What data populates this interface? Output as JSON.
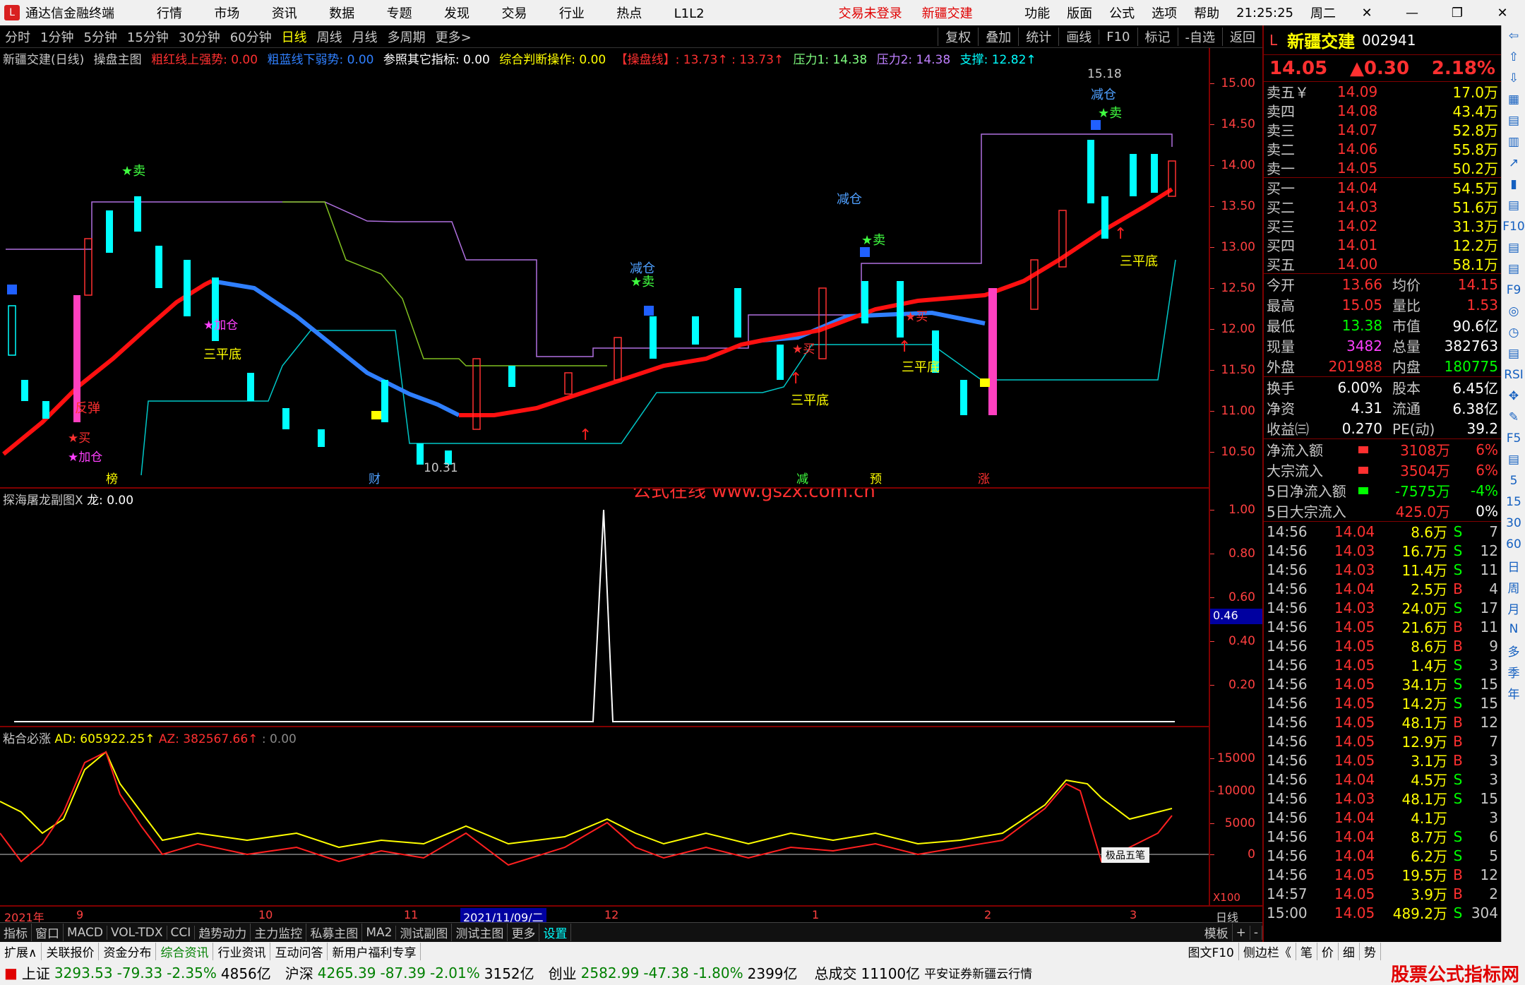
{
  "app": {
    "title": "通达信金融终端",
    "menu": [
      "行情",
      "市场",
      "资讯",
      "数据",
      "专题",
      "发现",
      "交易",
      "行业",
      "热点",
      "L1L2"
    ],
    "trade_status": "交易未登录",
    "stock_title": "新疆交建",
    "right_menu": [
      "功能",
      "版面",
      "公式",
      "选项",
      "帮助"
    ],
    "clock": "21:25:25",
    "weekday": "周二"
  },
  "toolbar": {
    "periods": [
      "分时",
      "1分钟",
      "5分钟",
      "15分钟",
      "30分钟",
      "60分钟",
      "日线",
      "周线",
      "月线",
      "多周期",
      "更多>"
    ],
    "active": "日线",
    "right": [
      "复权",
      "叠加",
      "统计",
      "画线",
      "F10",
      "标记",
      "-自选",
      "返回"
    ]
  },
  "main_legend": {
    "name": "新疆交建(日线)",
    "indicator": "操盘主图",
    "items": [
      {
        "text": "粗红线上强势: 0.00",
        "color": "#ff3030"
      },
      {
        "text": "粗蓝线下弱势: 0.00",
        "color": "#3080ff"
      },
      {
        "text": "参照其它指标: 0.00",
        "color": "#ffffff"
      },
      {
        "text": "综合判断操作: 0.00",
        "color": "#ffff00"
      },
      {
        "text": "【操盘线】: 13.73↑ : 13.73↑",
        "color": "#ff3030"
      },
      {
        "text": "压力1: 14.38",
        "color": "#80ff80"
      },
      {
        "text": "压力2: 14.38",
        "color": "#c080ff"
      },
      {
        "text": "支撑: 12.82↑",
        "color": "#00ffff"
      }
    ]
  },
  "main_yaxis": [
    "15.00",
    "14.50",
    "14.00",
    "13.50",
    "13.00",
    "12.50",
    "12.00",
    "11.50",
    "11.00",
    "10.50"
  ],
  "main_annotations": {
    "high_label": "15.18",
    "low_label": "10.31",
    "jiancang": "减仓",
    "mai": "★卖",
    "mai_buy": "★买",
    "jiacang": "★加仓",
    "fantan": "反弹",
    "sanpingdi": "三平底",
    "bottom_tags": [
      "榜",
      "财",
      "减",
      "预",
      "涨"
    ],
    "watermark": "公式在线  www.gszx.com.cn"
  },
  "sub1": {
    "legend": "探海屠龙副图X",
    "value_label": "龙: 0.00",
    "yaxis": [
      "1.00",
      "0.80",
      "0.60",
      "0.40",
      "0.20"
    ],
    "marker": "0.46"
  },
  "sub2": {
    "legend": "粘合必涨",
    "ad": "AD: 605922.25↑",
    "az": "AZ: 382567.66↑",
    "zero": ": 0.00",
    "yaxis": [
      "15000",
      "10000",
      "5000",
      "0"
    ],
    "tool": "极品五笔",
    "scale": "X100"
  },
  "xaxis": {
    "labels": [
      "2021年",
      "9",
      "10",
      "11",
      "2021/11/09/二",
      "12",
      "1",
      "2",
      "3"
    ],
    "right": "日线"
  },
  "bottom_tabs": [
    "指标",
    "窗口",
    "MACD",
    "VOL-TDX",
    "CCI",
    "趋势动力",
    "主力监控",
    "私募主图",
    "MA2",
    "测试副图",
    "测试主图",
    "更多",
    "设置"
  ],
  "bottom_tabs_selected": "设置",
  "bottom_tabs_right": [
    "模板",
    "+",
    "-"
  ],
  "bottom_tabs2": [
    "扩展∧",
    "关联报价",
    "资金分布",
    "综合资讯",
    "行业资讯",
    "互动问答",
    "新用户福利专享"
  ],
  "bottom_tabs2_right": [
    "图文F10",
    "侧边栏《",
    "笔",
    "价",
    "细",
    "势"
  ],
  "statusbar": {
    "items": [
      {
        "name": "上证",
        "value": "3293.53",
        "chg": "-79.33",
        "pct": "-2.35%",
        "amt": "4856亿"
      },
      {
        "name": "沪深",
        "value": "4265.39",
        "chg": "-87.39",
        "pct": "-2.01%",
        "amt": "3152亿"
      },
      {
        "name": "创业",
        "value": "2582.99",
        "chg": "-47.38",
        "pct": "-1.80%",
        "amt": "2399亿"
      }
    ],
    "total": "总成交",
    "total_amt": "11100亿",
    "broker": "平安证券新疆云行情",
    "corner": "股票公式指标网"
  },
  "quote": {
    "market": "L",
    "name": "新疆交建",
    "code": "002941",
    "price": "14.05",
    "change": "▲0.30",
    "pct": "2.18%",
    "asks": [
      {
        "label": "卖五￥",
        "price": "14.09",
        "vol": "17.0万"
      },
      {
        "label": "卖四",
        "price": "14.08",
        "vol": "43.4万"
      },
      {
        "label": "卖三",
        "price": "14.07",
        "vol": "52.8万"
      },
      {
        "label": "卖二",
        "price": "14.06",
        "vol": "55.8万"
      },
      {
        "label": "卖一",
        "price": "14.05",
        "vol": "50.2万"
      }
    ],
    "bids": [
      {
        "label": "买一",
        "price": "14.04",
        "vol": "54.5万"
      },
      {
        "label": "买二",
        "price": "14.03",
        "vol": "51.6万"
      },
      {
        "label": "买三",
        "price": "14.02",
        "vol": "31.3万"
      },
      {
        "label": "买四",
        "price": "14.01",
        "vol": "12.2万"
      },
      {
        "label": "买五",
        "price": "14.00",
        "vol": "58.1万"
      }
    ],
    "info": [
      {
        "a": "今开",
        "b": "13.66",
        "bc": "#ff3030",
        "c": "均价",
        "d": "14.15",
        "dc": "#ff3030"
      },
      {
        "a": "最高",
        "b": "15.05",
        "bc": "#ff3030",
        "c": "量比",
        "d": "1.53",
        "dc": "#ff3030"
      },
      {
        "a": "最低",
        "b": "13.38",
        "bc": "#00ff00",
        "c": "市值",
        "d": "90.6亿",
        "dc": "#ffffff"
      },
      {
        "a": "现量",
        "b": "3482",
        "bc": "#ff40ff",
        "c": "总量",
        "d": "382763",
        "dc": "#ffffff"
      },
      {
        "a": "外盘",
        "b": "201988",
        "bc": "#ff3030",
        "c": "内盘",
        "d": "180775",
        "dc": "#00ff00"
      }
    ],
    "info2": [
      {
        "a": "换手",
        "b": "6.00%",
        "bc": "#ffffff",
        "c": "股本",
        "d": "6.45亿",
        "dc": "#ffffff"
      },
      {
        "a": "净资",
        "b": "4.31",
        "bc": "#ffffff",
        "c": "流通",
        "d": "6.38亿",
        "dc": "#ffffff"
      },
      {
        "a": "收益㈢",
        "b": "0.270",
        "bc": "#ffffff",
        "c": "PE(动)",
        "d": "39.2",
        "dc": "#ffffff"
      }
    ],
    "flows": [
      {
        "a": "净流入额",
        "bar": "#ff3030",
        "b": "3108万",
        "bc": "#ff3030",
        "c": "6%",
        "cc": "#ff3030"
      },
      {
        "a": "大宗流入",
        "bar": "#ff3030",
        "b": "3504万",
        "bc": "#ff3030",
        "c": "6%",
        "cc": "#ff3030"
      },
      {
        "a": "5日净流入额",
        "bar": "#00ff00",
        "b": "-7575万",
        "bc": "#00ff00",
        "c": "-4%",
        "cc": "#00ff00"
      },
      {
        "a": "5日大宗流入",
        "bar": "#000000",
        "b": "425.0万",
        "bc": "#ff3030",
        "c": "0%",
        "cc": "#ffffff"
      }
    ],
    "ticks": [
      {
        "t": "14:56",
        "p": "14.04",
        "v": "8.6万",
        "s": "S",
        "n": "7"
      },
      {
        "t": "14:56",
        "p": "14.03",
        "v": "16.7万",
        "s": "S",
        "n": "12"
      },
      {
        "t": "14:56",
        "p": "14.03",
        "v": "11.4万",
        "s": "S",
        "n": "11"
      },
      {
        "t": "14:56",
        "p": "14.04",
        "v": "2.5万",
        "s": "B",
        "n": "4"
      },
      {
        "t": "14:56",
        "p": "14.03",
        "v": "24.0万",
        "s": "S",
        "n": "17"
      },
      {
        "t": "14:56",
        "p": "14.05",
        "v": "21.6万",
        "s": "B",
        "n": "11"
      },
      {
        "t": "14:56",
        "p": "14.05",
        "v": "8.6万",
        "s": "B",
        "n": "9"
      },
      {
        "t": "14:56",
        "p": "14.05",
        "v": "1.4万",
        "s": "S",
        "n": "3"
      },
      {
        "t": "14:56",
        "p": "14.05",
        "v": "34.1万",
        "s": "S",
        "n": "15"
      },
      {
        "t": "14:56",
        "p": "14.05",
        "v": "14.2万",
        "s": "S",
        "n": "15"
      },
      {
        "t": "14:56",
        "p": "14.05",
        "v": "48.1万",
        "s": "B",
        "n": "12"
      },
      {
        "t": "14:56",
        "p": "14.05",
        "v": "12.9万",
        "s": "B",
        "n": "7"
      },
      {
        "t": "14:56",
        "p": "14.05",
        "v": "3.1万",
        "s": "B",
        "n": "3"
      },
      {
        "t": "14:56",
        "p": "14.04",
        "v": "4.5万",
        "s": "S",
        "n": "3"
      },
      {
        "t": "14:56",
        "p": "14.03",
        "v": "48.1万",
        "s": "S",
        "n": "15"
      },
      {
        "t": "14:56",
        "p": "14.04",
        "v": "4.1万",
        "s": "",
        "n": "3"
      },
      {
        "t": "14:56",
        "p": "14.04",
        "v": "8.7万",
        "s": "S",
        "n": "6"
      },
      {
        "t": "14:56",
        "p": "14.04",
        "v": "6.2万",
        "s": "S",
        "n": "5"
      },
      {
        "t": "14:56",
        "p": "14.05",
        "v": "19.5万",
        "s": "B",
        "n": "12"
      },
      {
        "t": "14:57",
        "p": "14.05",
        "v": "3.9万",
        "s": "B",
        "n": "2"
      },
      {
        "t": "15:00",
        "p": "14.05",
        "v": "489.2万",
        "s": "S",
        "n": "304"
      }
    ]
  },
  "iconstrip": [
    "⇦",
    "⇧",
    "⇩",
    "▦",
    "▤",
    "▥",
    "↗",
    "▮",
    "▤",
    "F10",
    "▤",
    "▤",
    "F9",
    "◎",
    "◷",
    "▤",
    "RSI",
    "✥",
    "✎",
    "F5",
    "▤",
    "5",
    "15",
    "30",
    "60",
    "日",
    "周",
    "月",
    "N",
    "多",
    "季",
    "年"
  ]
}
